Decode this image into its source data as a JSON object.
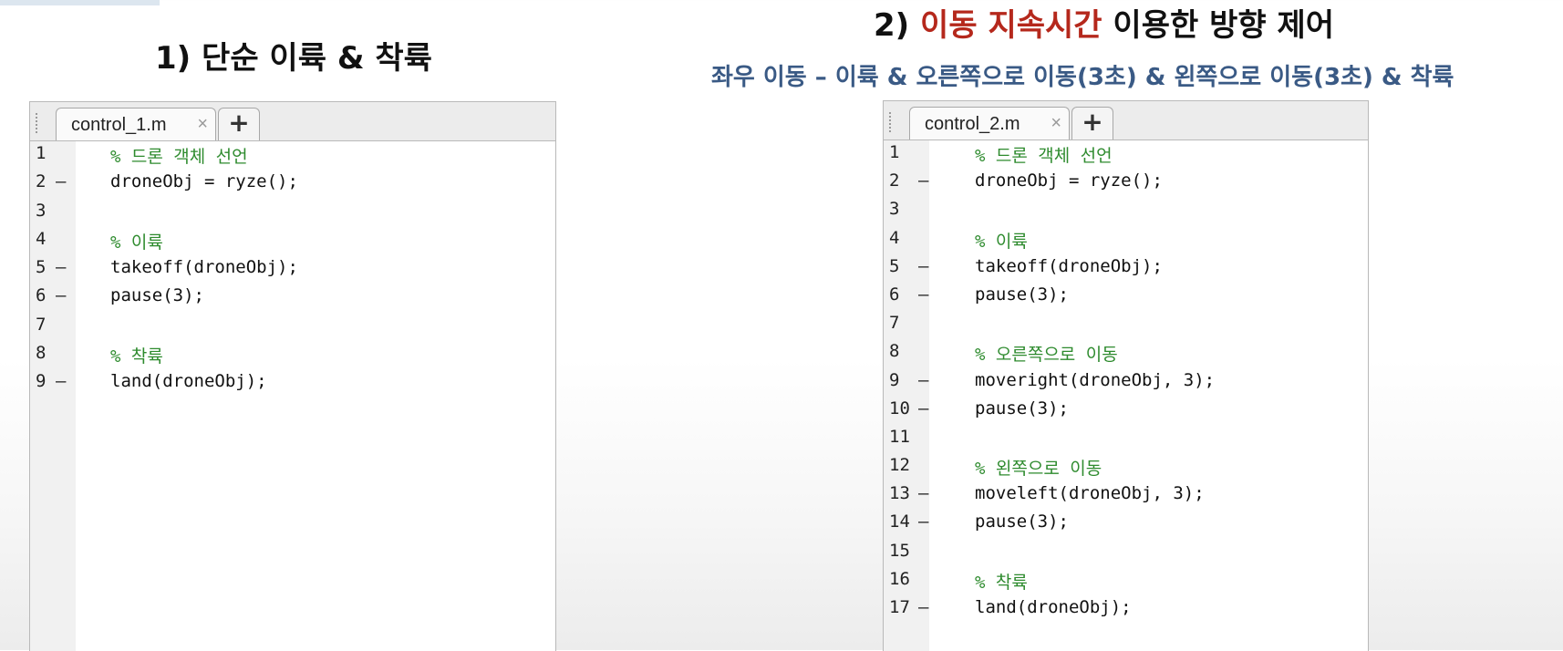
{
  "headings": {
    "left_title": "1) 단순 이륙 & 착륙",
    "right_title_prefix": "2) ",
    "right_title_accent": "이동 지속시간",
    "right_title_suffix": " 이용한 방향 제어",
    "right_subtitle": "좌우 이동 – 이륙 & 오른쪽으로 이동(3초) & 왼쪽으로 이동(3초) & 착륙"
  },
  "colors": {
    "accent_red": "#b5281c",
    "subtitle_blue": "#3a5a85",
    "comment_green": "#2e8b2e"
  },
  "editor1": {
    "tab_name": "control_1.m",
    "close_glyph": "×",
    "add_glyph": "+",
    "lines": [
      {
        "num": "1",
        "bp": "",
        "code": "% 드론 객체 선언",
        "comment": true
      },
      {
        "num": "2",
        "bp": "–",
        "code": "droneObj = ryze();",
        "comment": false
      },
      {
        "num": "3",
        "bp": "",
        "code": "",
        "comment": false
      },
      {
        "num": "4",
        "bp": "",
        "code": "% 이륙",
        "comment": true
      },
      {
        "num": "5",
        "bp": "–",
        "code": "takeoff(droneObj);",
        "comment": false
      },
      {
        "num": "6",
        "bp": "–",
        "code": "pause(3);",
        "comment": false
      },
      {
        "num": "7",
        "bp": "",
        "code": "",
        "comment": false
      },
      {
        "num": "8",
        "bp": "",
        "code": "% 착륙",
        "comment": true
      },
      {
        "num": "9",
        "bp": "–",
        "code": "land(droneObj);",
        "comment": false
      }
    ]
  },
  "editor2": {
    "tab_name": "control_2.m",
    "close_glyph": "×",
    "add_glyph": "+",
    "lines": [
      {
        "num": "1",
        "bp": "",
        "code": "% 드론 객체 선언",
        "comment": true
      },
      {
        "num": "2",
        "bp": "–",
        "code": "droneObj = ryze();",
        "comment": false
      },
      {
        "num": "3",
        "bp": "",
        "code": "",
        "comment": false
      },
      {
        "num": "4",
        "bp": "",
        "code": "% 이륙",
        "comment": true
      },
      {
        "num": "5",
        "bp": "–",
        "code": "takeoff(droneObj);",
        "comment": false
      },
      {
        "num": "6",
        "bp": "–",
        "code": "pause(3);",
        "comment": false
      },
      {
        "num": "7",
        "bp": "",
        "code": "",
        "comment": false
      },
      {
        "num": "8",
        "bp": "",
        "code": "% 오른쪽으로 이동",
        "comment": true
      },
      {
        "num": "9",
        "bp": "–",
        "code": "moveright(droneObj, 3);",
        "comment": false
      },
      {
        "num": "10",
        "bp": "–",
        "code": "pause(3);",
        "comment": false
      },
      {
        "num": "11",
        "bp": "",
        "code": "",
        "comment": false
      },
      {
        "num": "12",
        "bp": "",
        "code": "% 왼쪽으로 이동",
        "comment": true
      },
      {
        "num": "13",
        "bp": "–",
        "code": "moveleft(droneObj, 3);",
        "comment": false
      },
      {
        "num": "14",
        "bp": "–",
        "code": "pause(3);",
        "comment": false
      },
      {
        "num": "15",
        "bp": "",
        "code": "",
        "comment": false
      },
      {
        "num": "16",
        "bp": "",
        "code": "% 착륙",
        "comment": true
      },
      {
        "num": "17",
        "bp": "–",
        "code": "land(droneObj);",
        "comment": false
      }
    ]
  }
}
